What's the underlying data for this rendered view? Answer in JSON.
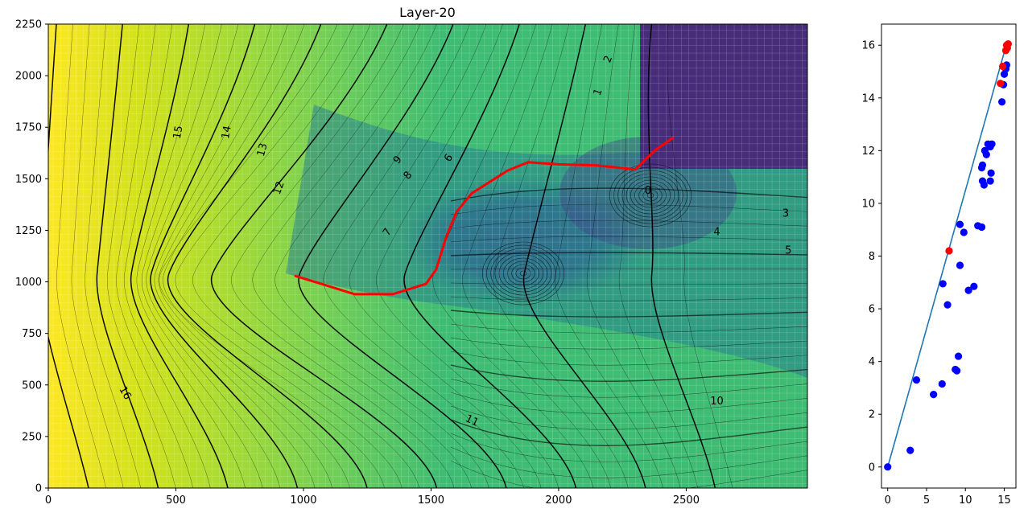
{
  "chart_data": [
    {
      "type": "heatmap",
      "title": "Layer-20",
      "xlim": [
        0,
        2975
      ],
      "ylim": [
        0,
        2250
      ],
      "x_ticks": [
        "0",
        "500",
        "1000",
        "1500",
        "2000",
        "2500"
      ],
      "y_ticks": [
        "0",
        "250",
        "500",
        "750",
        "1000",
        "1250",
        "1500",
        "1750",
        "2000",
        "2250"
      ],
      "x_tick_values": [
        0,
        500,
        1000,
        1500,
        2000,
        2500
      ],
      "y_tick_values": [
        0,
        250,
        500,
        750,
        1000,
        1250,
        1500,
        1750,
        2000,
        2250
      ],
      "colormap": [
        "#fde725",
        "#b5de2b",
        "#6ece58",
        "#35b779",
        "#1f9e89",
        "#26828e",
        "#31688e",
        "#3e4989",
        "#482878",
        "#440154"
      ],
      "grid": true,
      "contour_labels": [
        {
          "text": "16",
          "x": 300,
          "y": 460,
          "rot": 60
        },
        {
          "text": "15",
          "x": 510,
          "y": 1725,
          "rot": -80
        },
        {
          "text": "14",
          "x": 700,
          "y": 1725,
          "rot": -80
        },
        {
          "text": "13",
          "x": 840,
          "y": 1640,
          "rot": -75
        },
        {
          "text": "12",
          "x": 905,
          "y": 1455,
          "rot": -70
        },
        {
          "text": "11",
          "x": 1660,
          "y": 325,
          "rot": 25
        },
        {
          "text": "10",
          "x": 2620,
          "y": 420,
          "rot": 0
        },
        {
          "text": "9",
          "x": 1370,
          "y": 1590,
          "rot": -50
        },
        {
          "text": "8",
          "x": 1410,
          "y": 1515,
          "rot": -50
        },
        {
          "text": "7",
          "x": 1330,
          "y": 1240,
          "rot": -55
        },
        {
          "text": "6",
          "x": 1570,
          "y": 1600,
          "rot": -55
        },
        {
          "text": "5",
          "x": 2900,
          "y": 1150,
          "rot": 0
        },
        {
          "text": "4",
          "x": 2620,
          "y": 1240,
          "rot": 0
        },
        {
          "text": "3",
          "x": 2890,
          "y": 1330,
          "rot": 0
        },
        {
          "text": "2",
          "x": 2195,
          "y": 2080,
          "rot": -70
        },
        {
          "text": "1",
          "x": 2155,
          "y": 1920,
          "rot": -70
        },
        {
          "text": "0",
          "x": 2350,
          "y": 1440,
          "rot": 0
        }
      ],
      "red_line": [
        [
          965,
          1030
        ],
        [
          1070,
          990
        ],
        [
          1200,
          940
        ],
        [
          1350,
          940
        ],
        [
          1480,
          990
        ],
        [
          1520,
          1060
        ],
        [
          1560,
          1220
        ],
        [
          1600,
          1340
        ],
        [
          1660,
          1430
        ],
        [
          1800,
          1540
        ],
        [
          1880,
          1580
        ],
        [
          2000,
          1570
        ],
        [
          2150,
          1565
        ],
        [
          2300,
          1545
        ],
        [
          2380,
          1640
        ],
        [
          2450,
          1700
        ]
      ]
    },
    {
      "type": "scatter",
      "xlim": [
        -0.8,
        16.5
      ],
      "ylim": [
        -0.8,
        16.8
      ],
      "x_ticks": [
        "0",
        "5",
        "10",
        "15"
      ],
      "y_ticks": [
        "0",
        "2",
        "4",
        "6",
        "8",
        "10",
        "12",
        "14",
        "16"
      ],
      "x_tick_values": [
        0,
        5,
        10,
        15
      ],
      "y_tick_values": [
        0,
        2,
        4,
        6,
        8,
        10,
        12,
        14,
        16
      ],
      "fit_line": {
        "x": [
          0,
          15.3
        ],
        "y": [
          0,
          16.05
        ],
        "color": "#1f77b4"
      },
      "series": [
        {
          "color": "#0000ff",
          "points": [
            [
              0,
              0
            ],
            [
              2.9,
              0.63
            ],
            [
              3.7,
              3.3
            ],
            [
              5.9,
              2.75
            ],
            [
              7.0,
              3.15
            ],
            [
              8.7,
              3.7
            ],
            [
              8.9,
              3.65
            ],
            [
              9.1,
              4.2
            ],
            [
              7.1,
              6.95
            ],
            [
              7.7,
              6.15
            ],
            [
              9.3,
              7.65
            ],
            [
              10.4,
              6.7
            ],
            [
              11.1,
              6.85
            ],
            [
              9.3,
              9.2
            ],
            [
              9.8,
              8.9
            ],
            [
              11.6,
              9.15
            ],
            [
              12.1,
              9.1
            ],
            [
              12.2,
              10.85
            ],
            [
              12.4,
              10.7
            ],
            [
              13.2,
              10.85
            ],
            [
              13.3,
              11.15
            ],
            [
              12.1,
              11.35
            ],
            [
              12.2,
              11.45
            ],
            [
              12.5,
              12.0
            ],
            [
              12.7,
              11.85
            ],
            [
              12.9,
              12.25
            ],
            [
              13.2,
              12.15
            ],
            [
              13.4,
              12.25
            ],
            [
              14.7,
              13.85
            ],
            [
              14.9,
              14.5
            ],
            [
              15.0,
              14.9
            ],
            [
              15.2,
              15.1
            ],
            [
              15.3,
              15.25
            ]
          ]
        },
        {
          "color": "#ff0000",
          "points": [
            [
              7.9,
              8.2
            ],
            [
              14.5,
              14.55
            ],
            [
              14.8,
              15.2
            ],
            [
              15.2,
              15.8
            ],
            [
              15.4,
              15.9
            ],
            [
              15.5,
              16.05
            ],
            [
              15.3,
              16.0
            ]
          ]
        }
      ]
    }
  ]
}
